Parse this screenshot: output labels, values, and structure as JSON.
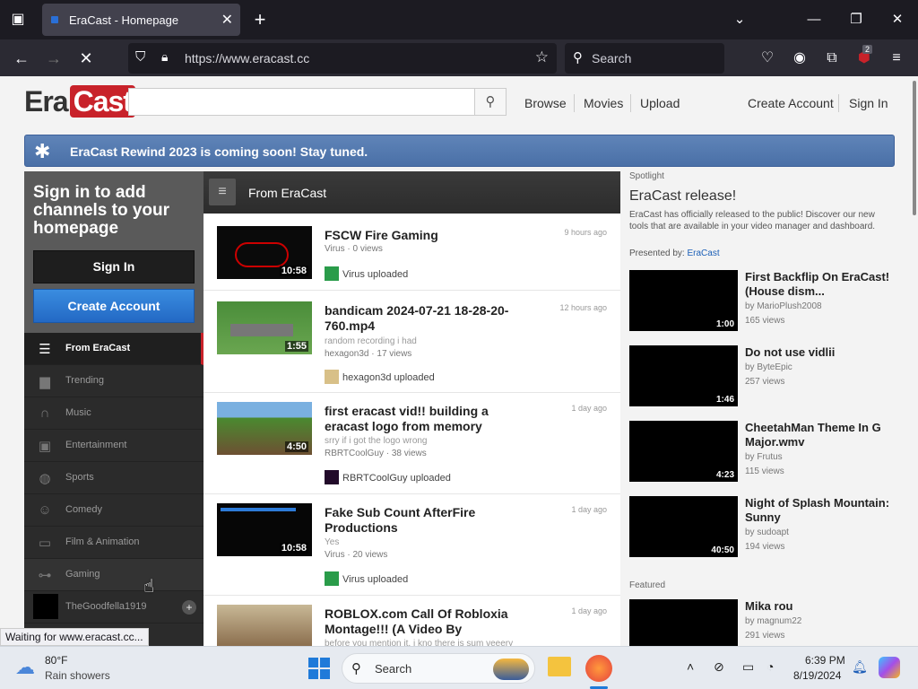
{
  "browser": {
    "tab_title": "EraCast - Homepage",
    "url": "https://www.eracast.cc",
    "search_placeholder": "Search",
    "extension_badge": "2",
    "status_text": "Waiting for www.eracast.cc..."
  },
  "site": {
    "logo_era": "Era",
    "logo_cast": "Cast",
    "nav": [
      "Browse",
      "Movies",
      "Upload"
    ],
    "create_account": "Create Account",
    "sign_in": "Sign In",
    "notice": "EraCast Rewind 2023 is coming soon! Stay tuned."
  },
  "guide": {
    "promo": "Sign in to add channels to your homepage",
    "sign_in_button": "Sign In",
    "create_account_button": "Create Account",
    "items": [
      {
        "label": "From EraCast",
        "icon": "list-icon"
      },
      {
        "label": "Trending",
        "icon": "bar-chart-icon"
      },
      {
        "label": "Music",
        "icon": "headphones-icon"
      },
      {
        "label": "Entertainment",
        "icon": "entertainment-icon"
      },
      {
        "label": "Sports",
        "icon": "sports-icon"
      },
      {
        "label": "Comedy",
        "icon": "mask-icon"
      },
      {
        "label": "Film & Animation",
        "icon": "film-icon"
      },
      {
        "label": "Gaming",
        "icon": "gamepad-icon"
      },
      {
        "label": "TheGoodfella1919",
        "icon": "channel-thumb"
      }
    ]
  },
  "feed": {
    "header": "From EraCast",
    "videos": [
      {
        "title": "FSCW Fire Gaming",
        "age": "9 hours ago",
        "desc": "",
        "meta": "Virus · 0 views",
        "uploader": "Virus uploaded",
        "duration": "10:58"
      },
      {
        "title": "bandicam 2024-07-21 18-28-20-760.mp4",
        "age": "12 hours ago",
        "desc": "random recording i had",
        "meta": "hexagon3d · 17 views",
        "uploader": "hexagon3d uploaded",
        "duration": "1:55"
      },
      {
        "title": "first eracast vid!! building a eracast logo from memory",
        "age": "1 day ago",
        "desc": "srry if i got the logo wrong",
        "meta": "RBRTCoolGuy · 38 views",
        "uploader": "RBRTCoolGuy uploaded",
        "duration": "4:50"
      },
      {
        "title": "Fake Sub Count AfterFire Productions",
        "age": "1 day ago",
        "desc": "Yes",
        "meta": "Virus · 20 views",
        "uploader": "Virus uploaded",
        "duration": "10:58"
      },
      {
        "title": "ROBLOX.com Call Of Robloxia Montage!!! (A Video By",
        "age": "1 day ago",
        "desc": "before you mention it, i kno there is sum veeery",
        "meta": "",
        "uploader": "",
        "duration": ""
      }
    ]
  },
  "spotlight": {
    "label": "Spotlight",
    "title": "EraCast release!",
    "body": "EraCast has officially released to the public! Discover our new tools that are available in your video manager and dashboard.",
    "presented_by": "Presented by:",
    "presented_link": "EraCast",
    "videos": [
      {
        "title": "First Backflip On EraCast! (House dism...",
        "by": "by MarioPlush2008",
        "views": "165 views",
        "duration": "1:00"
      },
      {
        "title": "Do not use vidlii",
        "by": "by ByteEpic",
        "views": "257 views",
        "duration": "1:46"
      },
      {
        "title": "CheetahMan Theme In G Major.wmv",
        "by": "by Frutus",
        "views": "115 views",
        "duration": "4:23"
      },
      {
        "title": "Night of Splash Mountain: Sunny",
        "by": "by sudoapt",
        "views": "194 views",
        "duration": "40:50"
      }
    ],
    "featured_label": "Featured",
    "featured": {
      "title": "Mika rou",
      "by": "by magnum22",
      "views": "291 views"
    }
  },
  "taskbar": {
    "temp": "80°F",
    "weather": "Rain showers",
    "search": "Search",
    "time": "6:39 PM",
    "date": "8/19/2024"
  }
}
